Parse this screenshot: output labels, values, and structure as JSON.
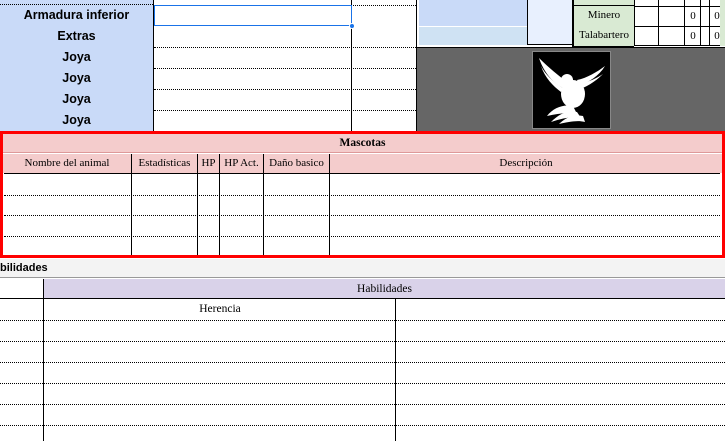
{
  "equipment": {
    "rows": [
      {
        "label": "Armadura inferior"
      },
      {
        "label": "Extras"
      },
      {
        "label": "Joya"
      },
      {
        "label": "Joya"
      },
      {
        "label": "Joya"
      },
      {
        "label": "Joya"
      }
    ]
  },
  "crafts": [
    {
      "name": "Minero",
      "v1": "0",
      "v2": "0"
    },
    {
      "name": "Talabartero",
      "v1": "0",
      "v2": "0"
    }
  ],
  "mascotas": {
    "title": "Mascotas",
    "columns": [
      "Nombre del animal",
      "Estadísticas",
      "HP",
      "HP Act.",
      "Daño basico",
      "Descripción"
    ]
  },
  "habilidades": {
    "section_label": "bilidades",
    "header": "Habilidades",
    "sub_header": "Herencia"
  },
  "colors": {
    "equipment_label_bg": "#c9daf8",
    "craft_bg": "#d9ead3",
    "mascotas_header_bg": "#f4cccc",
    "habilidades_header_bg": "#d9d2e9",
    "selection_border": "#ff0000",
    "active_cell": "#1a73e8",
    "emblem_bg": "#666666"
  },
  "icons": {
    "emblem": "dove-icon"
  }
}
